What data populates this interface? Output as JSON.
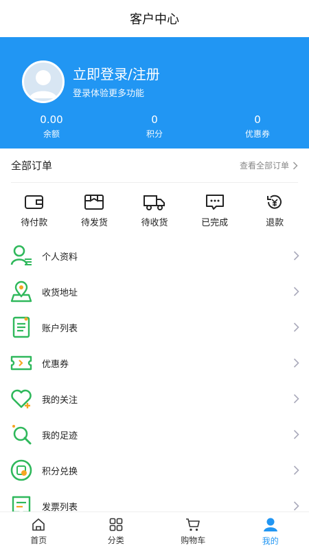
{
  "header": {
    "title": "客户中心"
  },
  "profile": {
    "login_title": "立即登录/注册",
    "login_subtitle": "登录体验更多功能",
    "stats": [
      {
        "value": "0.00",
        "label": "余额"
      },
      {
        "value": "0",
        "label": "积分"
      },
      {
        "value": "0",
        "label": "优惠券"
      }
    ]
  },
  "orders": {
    "title": "全部订单",
    "view_all": "查看全部订单",
    "statuses": [
      {
        "label": "待付款",
        "icon": "wallet-icon"
      },
      {
        "label": "待发货",
        "icon": "package-icon"
      },
      {
        "label": "待收货",
        "icon": "truck-icon"
      },
      {
        "label": "已完成",
        "icon": "chat-done-icon"
      },
      {
        "label": "退款",
        "icon": "refund-yen-icon"
      }
    ]
  },
  "menu": [
    {
      "label": "个人资料",
      "icon": "user-profile-icon"
    },
    {
      "label": "收货地址",
      "icon": "location-pin-icon"
    },
    {
      "label": "账户列表",
      "icon": "account-list-icon"
    },
    {
      "label": "优惠券",
      "icon": "coupon-icon"
    },
    {
      "label": "我的关注",
      "icon": "heart-icon"
    },
    {
      "label": "我的足迹",
      "icon": "footprint-icon"
    },
    {
      "label": "积分兑换",
      "icon": "points-exchange-icon"
    },
    {
      "label": "发票列表",
      "icon": "invoice-icon"
    }
  ],
  "tabbar": [
    {
      "label": "首页",
      "icon": "home-icon"
    },
    {
      "label": "分类",
      "icon": "grid-icon"
    },
    {
      "label": "购物车",
      "icon": "cart-icon"
    },
    {
      "label": "我的",
      "icon": "user-icon",
      "active": true
    }
  ],
  "colors": {
    "primary": "#2196f3",
    "green": "#2fb85b",
    "accent_orange": "#f5a623"
  }
}
